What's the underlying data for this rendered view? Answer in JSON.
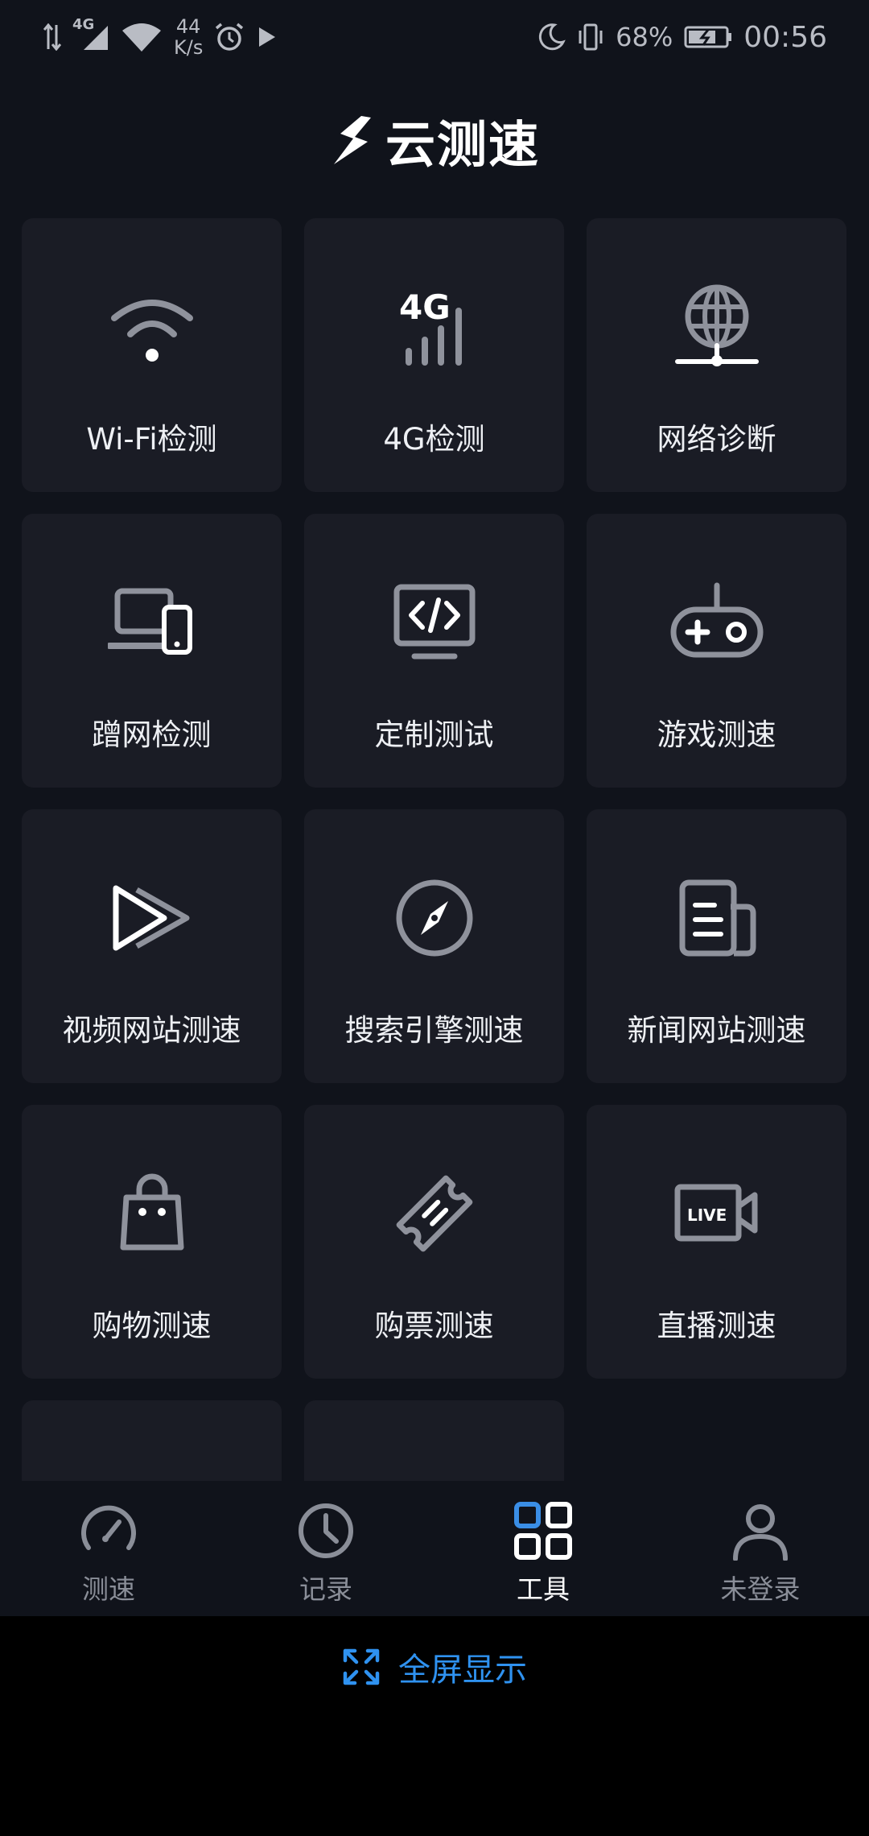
{
  "status_bar": {
    "network": "4G",
    "speed_value": "44",
    "speed_unit": "K/s",
    "battery": "68%",
    "time": "00:56"
  },
  "app": {
    "logo_text": "云测速"
  },
  "tools": [
    {
      "label": "Wi-Fi检测",
      "icon": "wifi-icon"
    },
    {
      "label": "4G检测",
      "icon": "cellular-4g-icon"
    },
    {
      "label": "网络诊断",
      "icon": "globe-network-icon"
    },
    {
      "label": "蹭网检测",
      "icon": "laptop-phone-icon"
    },
    {
      "label": "定制测试",
      "icon": "code-monitor-icon"
    },
    {
      "label": "游戏测速",
      "icon": "gamepad-icon"
    },
    {
      "label": "视频网站测速",
      "icon": "play-icon"
    },
    {
      "label": "搜索引擎测速",
      "icon": "compass-icon"
    },
    {
      "label": "新闻网站测速",
      "icon": "newspaper-icon"
    },
    {
      "label": "购物测速",
      "icon": "shopping-bag-icon"
    },
    {
      "label": "购票测速",
      "icon": "ticket-icon"
    },
    {
      "label": "直播测速",
      "icon": "live-camera-icon"
    }
  ],
  "nav": [
    {
      "label": "测速",
      "icon": "speedometer-icon"
    },
    {
      "label": "记录",
      "icon": "clock-icon"
    },
    {
      "label": "工具",
      "icon": "grid-icon"
    },
    {
      "label": "未登录",
      "icon": "user-icon"
    }
  ],
  "nav_active_index": 2,
  "fullscreen": {
    "label": "全屏显示"
  },
  "colors": {
    "background": "#10131b",
    "card": "#1a1c25",
    "accent": "#2f92f0",
    "icon": "#8f929c",
    "text": "#eef0f4"
  }
}
